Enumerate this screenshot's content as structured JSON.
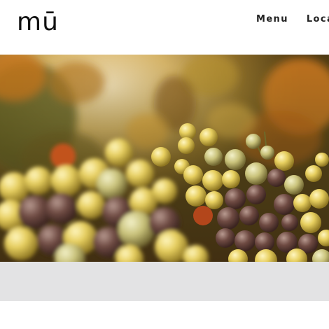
{
  "header": {
    "logo": "mū",
    "nav": [
      {
        "label": "Menu"
      },
      {
        "label": "Loca"
      }
    ]
  },
  "hero": {
    "icon": "grapes-photo"
  },
  "colors": {
    "band": "#e3e3e4",
    "text": "#222222"
  }
}
